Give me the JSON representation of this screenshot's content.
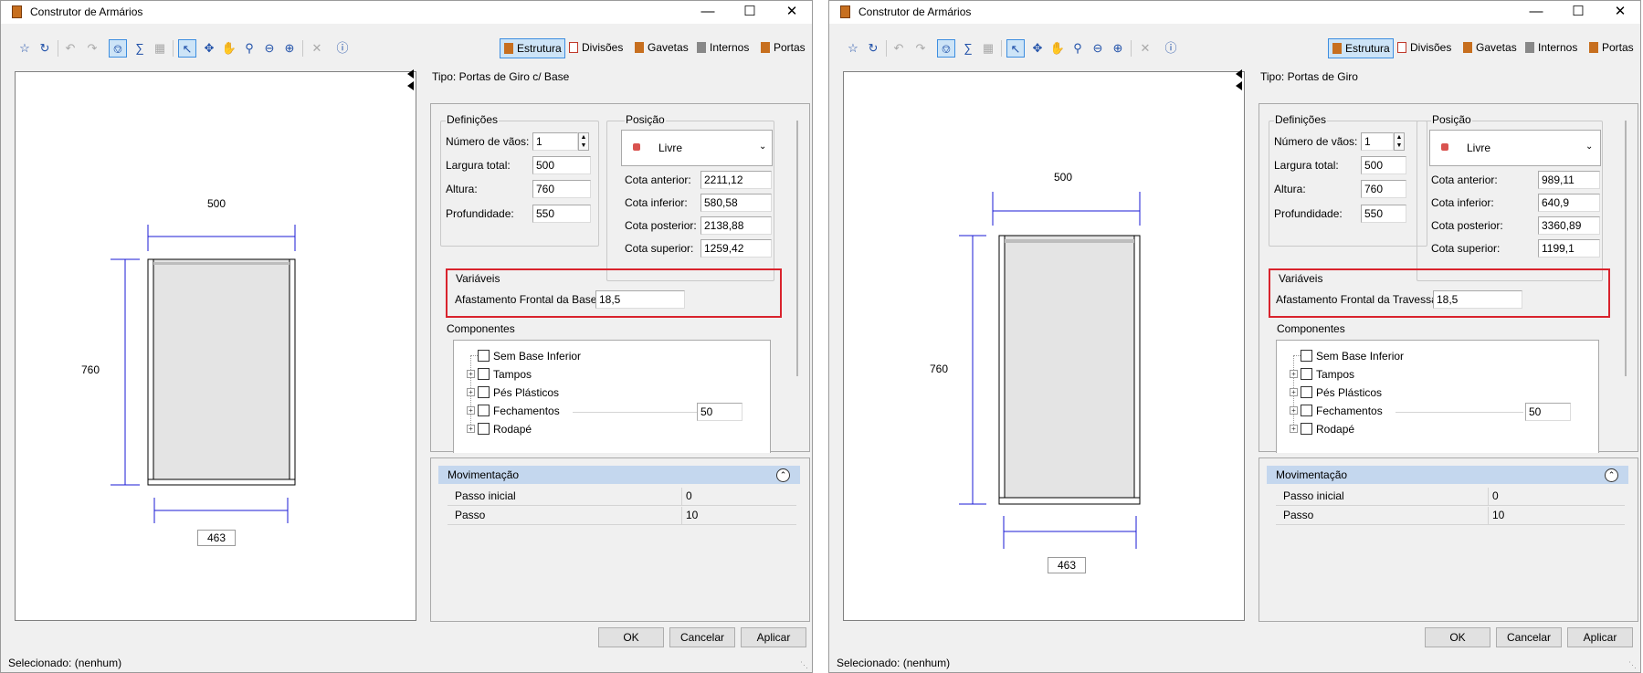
{
  "windows": [
    {
      "title": "Construtor de Armários",
      "toolbar_tabs": [
        "Estrutura",
        "Divisões",
        "Gavetas",
        "Internos",
        "Portas"
      ],
      "type_label": "Tipo: Portas de Giro c/ Base",
      "drawing": {
        "width": "500",
        "height": "760",
        "bottom": "463"
      },
      "definicoes": {
        "title": "Definições",
        "num_vaos_label": "Número de vãos:",
        "num_vaos": "1",
        "largura_label": "Largura total:",
        "largura": "500",
        "altura_label": "Altura:",
        "altura": "760",
        "profundidade_label": "Profundidade:",
        "profundidade": "550"
      },
      "posicao": {
        "title": "Posição",
        "value": "Livre",
        "anterior_label": "Cota anterior:",
        "anterior": "2211,12",
        "inferior_label": "Cota inferior:",
        "inferior": "580,58",
        "posterior_label": "Cota posterior:",
        "posterior": "2138,88",
        "superior_label": "Cota superior:",
        "superior": "1259,42"
      },
      "variaveis": {
        "title": "Variáveis",
        "label": "Afastamento Frontal da Base",
        "value": "18,5"
      },
      "componentes": {
        "title": "Componentes",
        "items": [
          "Sem Base Inferior",
          "Tampos",
          "Pés Plásticos",
          "Fechamentos",
          "Rodapé"
        ],
        "fechamentos_value": "50"
      },
      "movimentacao": {
        "title": "Movimentação",
        "passo_inicial_label": "Passo inicial",
        "passo_inicial": "0",
        "passo_label": "Passo",
        "passo": "10"
      },
      "buttons": {
        "ok": "OK",
        "cancel": "Cancelar",
        "apply": "Aplicar"
      },
      "status": "Selecionado: (nenhum)"
    },
    {
      "title": "Construtor de Armários",
      "toolbar_tabs": [
        "Estrutura",
        "Divisões",
        "Gavetas",
        "Internos",
        "Portas"
      ],
      "type_label": "Tipo: Portas de Giro",
      "drawing": {
        "width": "500",
        "height": "760",
        "bottom": "463"
      },
      "definicoes": {
        "title": "Definições",
        "num_vaos_label": "Número de vãos:",
        "num_vaos": "1",
        "largura_label": "Largura total:",
        "largura": "500",
        "altura_label": "Altura:",
        "altura": "760",
        "profundidade_label": "Profundidade:",
        "profundidade": "550"
      },
      "posicao": {
        "title": "Posição",
        "value": "Livre",
        "anterior_label": "Cota anterior:",
        "anterior": "989,11",
        "inferior_label": "Cota inferior:",
        "inferior": "640,9",
        "posterior_label": "Cota posterior:",
        "posterior": "3360,89",
        "superior_label": "Cota superior:",
        "superior": "1199,1"
      },
      "variaveis": {
        "title": "Variáveis",
        "label": "Afastamento Frontal da Travessa",
        "value": "18,5"
      },
      "componentes": {
        "title": "Componentes",
        "items": [
          "Sem Base Inferior",
          "Tampos",
          "Pés Plásticos",
          "Fechamentos",
          "Rodapé"
        ],
        "fechamentos_value": "50"
      },
      "movimentacao": {
        "title": "Movimentação",
        "passo_inicial_label": "Passo inicial",
        "passo_inicial": "0",
        "passo_label": "Passo",
        "passo": "10"
      },
      "buttons": {
        "ok": "OK",
        "cancel": "Cancelar",
        "apply": "Aplicar"
      },
      "status": "Selecionado: (nenhum)"
    }
  ]
}
